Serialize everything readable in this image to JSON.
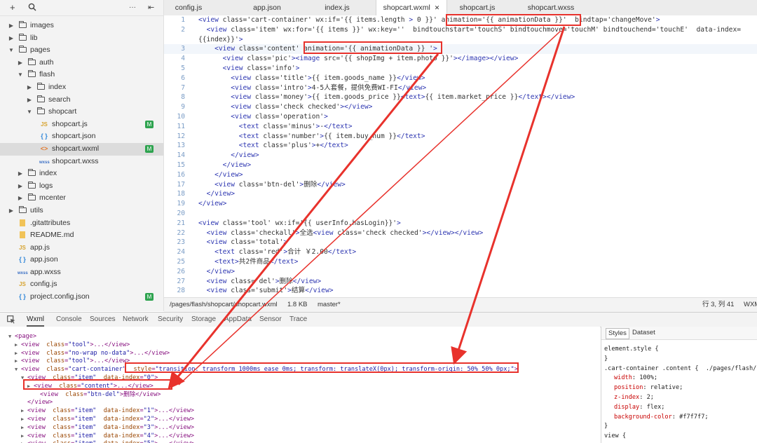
{
  "sidebar": {
    "toolbar": {
      "add": "+",
      "search_icon": "search-icon",
      "more": "···",
      "collapse": "⇤"
    },
    "tree": [
      {
        "label": "images",
        "kind": "folder",
        "depth": 0,
        "expanded": false
      },
      {
        "label": "lib",
        "kind": "folder",
        "depth": 0,
        "expanded": false
      },
      {
        "label": "pages",
        "kind": "folder",
        "depth": 0,
        "expanded": true
      },
      {
        "label": "auth",
        "kind": "folder",
        "depth": 1,
        "expanded": false
      },
      {
        "label": "flash",
        "kind": "folder",
        "depth": 1,
        "expanded": true
      },
      {
        "label": "index",
        "kind": "folder",
        "depth": 2,
        "expanded": false
      },
      {
        "label": "search",
        "kind": "folder",
        "depth": 2,
        "expanded": false
      },
      {
        "label": "shopcart",
        "kind": "folder",
        "depth": 2,
        "expanded": true
      },
      {
        "label": "shopcart.js",
        "kind": "js",
        "depth": 3,
        "badge": "M"
      },
      {
        "label": "shopcart.json",
        "kind": "json",
        "depth": 3
      },
      {
        "label": "shopcart.wxml",
        "kind": "wxml",
        "depth": 3,
        "badge": "M",
        "selected": true
      },
      {
        "label": "shopcart.wxss",
        "kind": "wxss",
        "depth": 3
      },
      {
        "label": "index",
        "kind": "folder",
        "depth": 1,
        "expanded": false
      },
      {
        "label": "logs",
        "kind": "folder",
        "depth": 1,
        "expanded": false
      },
      {
        "label": "mcenter",
        "kind": "folder",
        "depth": 1,
        "expanded": false
      },
      {
        "label": "utils",
        "kind": "folder",
        "depth": 0,
        "expanded": false
      },
      {
        "label": ".gitattributes",
        "kind": "file",
        "depth": 0
      },
      {
        "label": "README.md",
        "kind": "file",
        "depth": 0
      },
      {
        "label": "app.js",
        "kind": "js",
        "depth": 0
      },
      {
        "label": "app.json",
        "kind": "json",
        "depth": 0
      },
      {
        "label": "app.wxss",
        "kind": "wxss",
        "depth": 0
      },
      {
        "label": "config.js",
        "kind": "js",
        "depth": 0
      },
      {
        "label": "project.config.json",
        "kind": "json",
        "depth": 0,
        "badge": "M"
      }
    ]
  },
  "editor": {
    "tabs": [
      {
        "label": "config.js"
      },
      {
        "label": "app.json"
      },
      {
        "label": "index.js"
      },
      {
        "label": "shopcart.wxml",
        "active": true,
        "close": "✕"
      },
      {
        "label": "shopcart.js"
      },
      {
        "label": "shopcart.wxss"
      }
    ],
    "lines": [
      {
        "n": "1",
        "text": "<view class='cart-container' wx:if='{{ items.length > 0 }}' animation='{{ animationData }}'  bindtap='changeMove'>"
      },
      {
        "n": "2",
        "text": "  <view class='item' wx:for='{{ items }}' wx:key=''  bindtouchstart='touchS' bindtouchmove='touchM' bindtouchend='touchE'  data-index="
      },
      {
        "n": "",
        "text": "{{index}}'>"
      },
      {
        "n": "3",
        "text": "    <view class='content' animation='{{ animationData }} '>",
        "current": true
      },
      {
        "n": "4",
        "text": "      <view class='pic'><image src='{{ shopImg + item.photo }}'></image></view>"
      },
      {
        "n": "5",
        "text": "      <view class='info'>"
      },
      {
        "n": "6",
        "text": "        <view class='title'>{{ item.goods_name }}</view>"
      },
      {
        "n": "7",
        "text": "        <view class='intro'>4-5人套餐，提供免费WI-FI</view>"
      },
      {
        "n": "8",
        "text": "        <view class='money'>{{ item.goods_price }}<text>{{ item.market_price }}</text></view>"
      },
      {
        "n": "9",
        "text": "        <view class='check checked'></view>"
      },
      {
        "n": "10",
        "text": "        <view class='operation'>"
      },
      {
        "n": "11",
        "text": "          <text class='minus'>-</text>"
      },
      {
        "n": "12",
        "text": "          <text class='number'>{{ item.buy_num }}</text>"
      },
      {
        "n": "13",
        "text": "          <text class='plus'>+</text>"
      },
      {
        "n": "14",
        "text": "        </view>"
      },
      {
        "n": "15",
        "text": "      </view>"
      },
      {
        "n": "16",
        "text": "    </view>"
      },
      {
        "n": "17",
        "text": "    <view class='btn-del'>删除</view>"
      },
      {
        "n": "18",
        "text": "  </view>"
      },
      {
        "n": "19",
        "text": "</view>"
      },
      {
        "n": "20",
        "text": ""
      },
      {
        "n": "21",
        "text": "<view class='tool' wx:if='{{ userInfo.hasLogin}}'>"
      },
      {
        "n": "22",
        "text": "  <view class='checkall'>全选<view class='check checked'></view></view>"
      },
      {
        "n": "23",
        "text": "  <view class='total'>"
      },
      {
        "n": "24",
        "text": "    <text class='red'>合计 ￥2.00</text>"
      },
      {
        "n": "25",
        "text": "    <text>共2件商品</text>"
      },
      {
        "n": "26",
        "text": "  </view>"
      },
      {
        "n": "27",
        "text": "  <view class='del'>删除</view>"
      },
      {
        "n": "28",
        "text": "  <view class='submit'>结算</view>"
      }
    ],
    "status": {
      "path": "/pages/flash/shopcart/shopcart.wxml",
      "size": "1.8 KB",
      "branch": "master*",
      "position": "行 3, 列 41",
      "lang": "WXM"
    }
  },
  "devtools": {
    "inspect_icon": "inspect-cursor-icon",
    "tabs": [
      {
        "label": "Wxml",
        "active": true
      },
      {
        "label": "Console"
      },
      {
        "label": "Sources"
      },
      {
        "label": "Network"
      },
      {
        "label": "Security"
      },
      {
        "label": "Storage"
      },
      {
        "label": "AppData"
      },
      {
        "label": "Sensor"
      },
      {
        "label": "Trace"
      }
    ],
    "dom_lines": [
      {
        "tri": "▼",
        "text": "<page>"
      },
      {
        "tri": "▶",
        "text": "<view  class=\"tool\">...</view>"
      },
      {
        "tri": "▶",
        "text": "<view  class=\"no-wrap no-data\">...</view>"
      },
      {
        "tri": "▶",
        "text": "<view  class=\"tool\">...</view>"
      },
      {
        "tri": "▼",
        "text": "<view  class=\"cart-container\"  style=\"transition: transform 1000ms ease 0ms; transform: translateX(0px); transform-origin: 50% 50% 0px;\">"
      },
      {
        "tri": "▼",
        "text": "<view  class=\"item\"  data-index=\"0\">"
      },
      {
        "tri": "▶",
        "text": "<view  class=\"content\">...</view>"
      },
      {
        "tri": "",
        "text": "<view  class=\"btn-del\">删除</view>"
      },
      {
        "tri": "",
        "text": "</view>"
      },
      {
        "tri": "▶",
        "text": "<view  class=\"item\"  data-index=\"1\">...</view>"
      },
      {
        "tri": "▶",
        "text": "<view  class=\"item\"  data-index=\"2\">...</view>"
      },
      {
        "tri": "▶",
        "text": "<view  class=\"item\"  data-index=\"3\">...</view>"
      },
      {
        "tri": "▶",
        "text": "<view  class=\"item\"  data-index=\"4\">...</view>"
      },
      {
        "tri": "▶",
        "text": "<view  class=\"item\"  data-index=\"5\">...</view>"
      }
    ],
    "styles_tabs": [
      {
        "label": "Styles",
        "active": true
      },
      {
        "label": "Dataset"
      }
    ],
    "styles_lines": [
      {
        "kind": "selector",
        "text": "element.style {"
      },
      {
        "kind": "plain",
        "text": "}"
      },
      {
        "kind": "selector",
        "text": ".cart-container .content {  ./pages/flash/s..."
      },
      {
        "kind": "prop",
        "name": "width",
        "value": "100%;"
      },
      {
        "kind": "prop",
        "name": "position",
        "value": "relative;"
      },
      {
        "kind": "prop",
        "name": "z-index",
        "value": "2;"
      },
      {
        "kind": "prop",
        "name": "display",
        "value": "flex;"
      },
      {
        "kind": "prop",
        "name": "background-color",
        "value": "#f7f7f7;"
      },
      {
        "kind": "plain",
        "text": "}"
      },
      {
        "kind": "selector",
        "text": "view {"
      }
    ]
  },
  "colors": {
    "annotation": "#e8322c",
    "tag": "#2d36b1",
    "line_number": "#7a9cc6",
    "modified_badge": "#2ea34f"
  }
}
